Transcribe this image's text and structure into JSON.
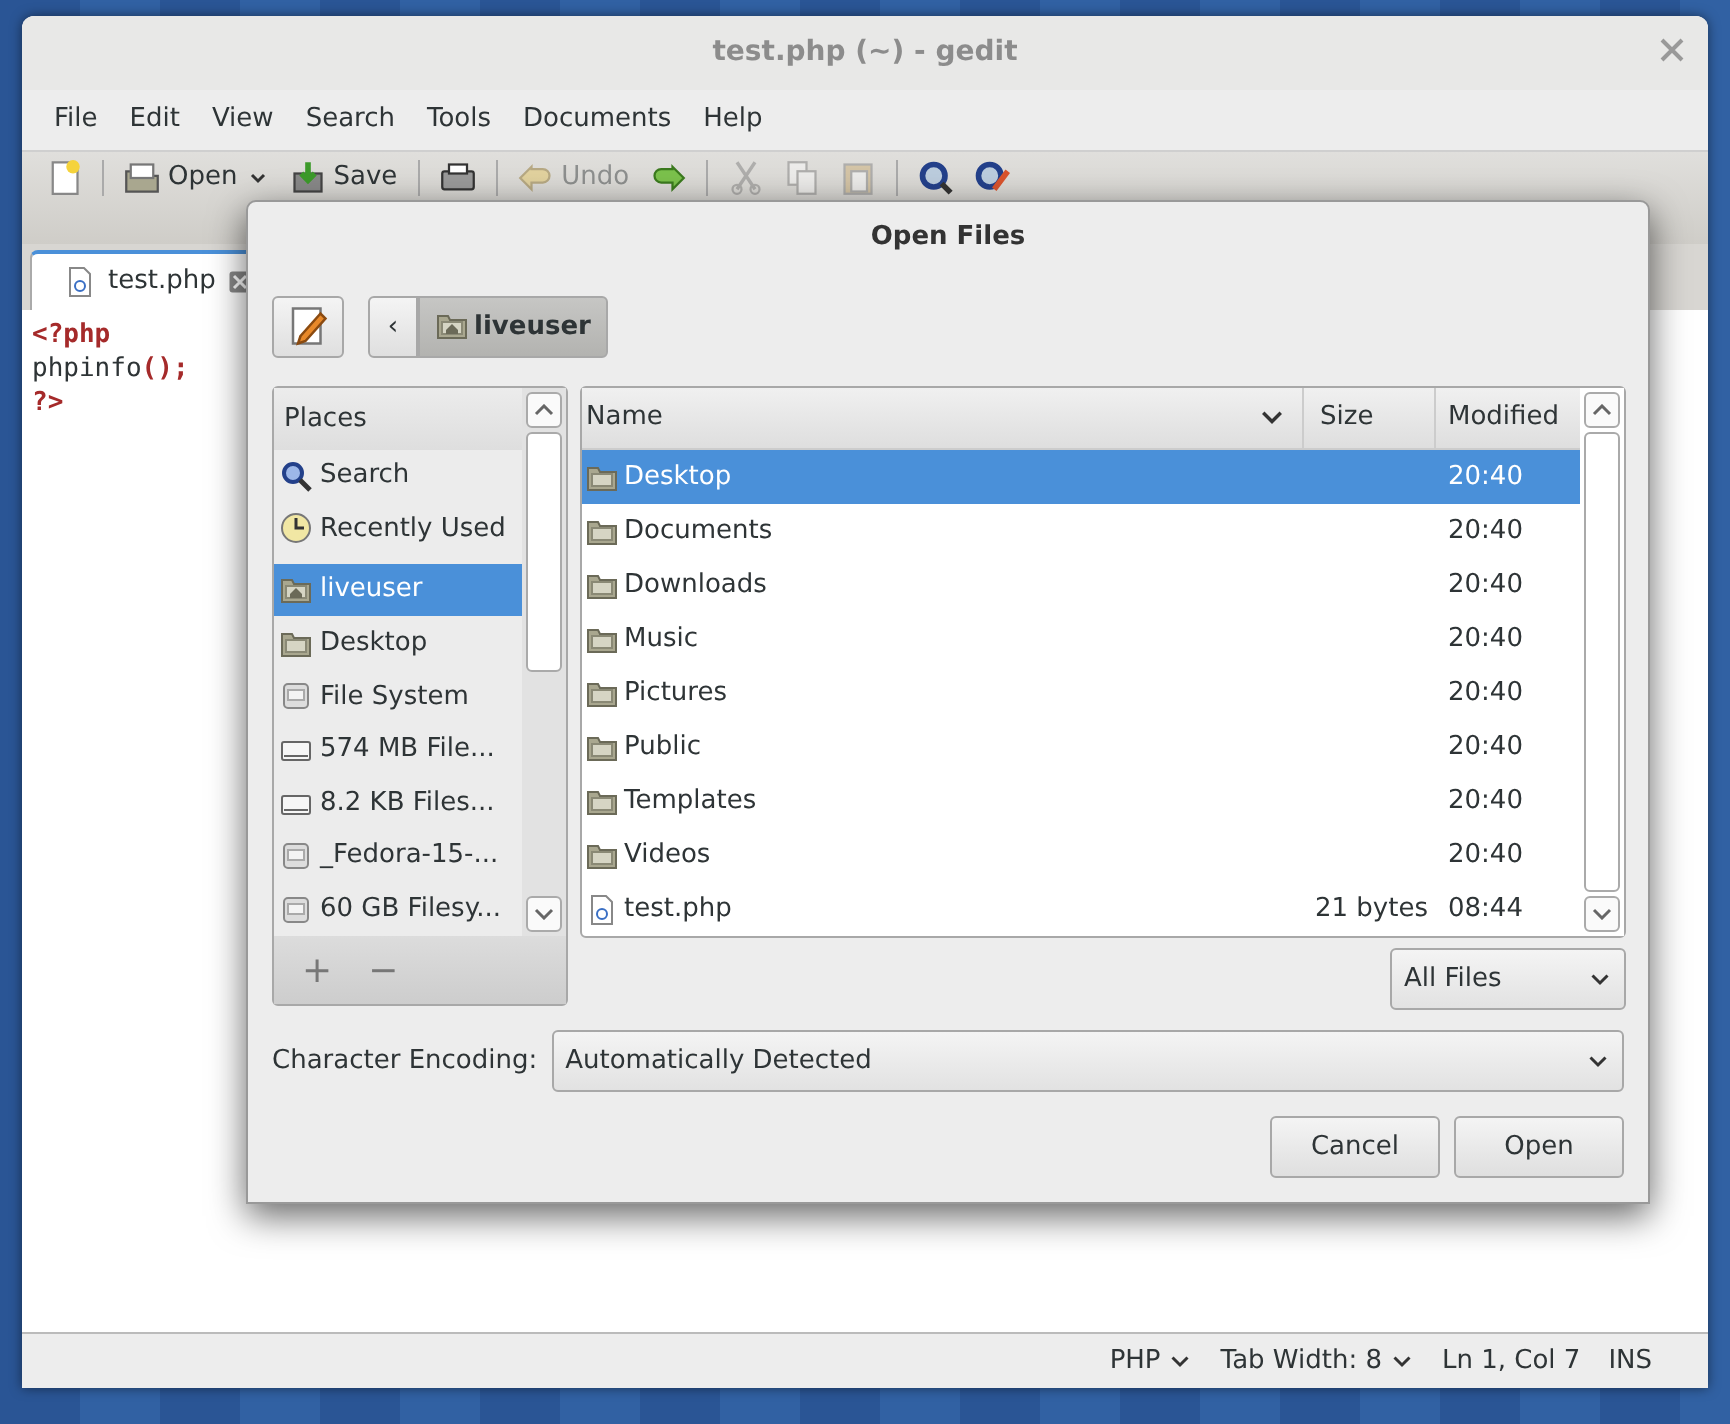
{
  "window": {
    "title": "test.php (~) - gedit"
  },
  "menu": [
    "File",
    "Edit",
    "View",
    "Search",
    "Tools",
    "Documents",
    "Help"
  ],
  "toolbar": [
    {
      "kind": "new",
      "disabled": false
    },
    {
      "kind": "open",
      "label": "Open",
      "disabled": false,
      "dropdown": true
    },
    {
      "kind": "save",
      "label": "Save",
      "disabled": false
    },
    {
      "kind": "print",
      "disabled": false
    },
    {
      "kind": "undo",
      "label": "Undo",
      "disabled": true
    },
    {
      "kind": "redo",
      "disabled": false
    },
    {
      "kind": "cut",
      "disabled": true
    },
    {
      "kind": "copy",
      "disabled": true
    },
    {
      "kind": "paste",
      "disabled": true
    },
    {
      "kind": "find",
      "disabled": false
    },
    {
      "kind": "replace",
      "disabled": false
    }
  ],
  "tabs": [
    {
      "label": "test.php",
      "selected": true
    }
  ],
  "code": [
    [
      {
        "text": "<?php",
        "kind": "keyword"
      }
    ],
    [
      {
        "text": "phpinfo",
        "kind": "plain"
      },
      {
        "text": "();",
        "kind": "keyword"
      }
    ],
    [
      {
        "text": "?>",
        "kind": "keyword"
      }
    ]
  ],
  "status_bar": {
    "language": "PHP",
    "tab_width": "Tab Width:  8",
    "position": "Ln 1, Col 7",
    "mode": "INS"
  },
  "dialog": {
    "title": "Open Files",
    "back": "‹",
    "path": [
      {
        "label": "liveuser",
        "selected": true
      }
    ],
    "places_header": "Places",
    "places": [
      {
        "label": "Search",
        "kind": "search",
        "selected": false
      },
      {
        "label": "Recently Used",
        "kind": "recent",
        "selected": false
      },
      {
        "label": "liveuser",
        "kind": "home",
        "selected": true
      },
      {
        "label": "Desktop",
        "kind": "folder",
        "selected": false
      },
      {
        "label": "File System",
        "kind": "disk",
        "selected": false
      },
      {
        "label": "574 MB File...",
        "kind": "drive",
        "selected": false
      },
      {
        "label": "8.2 KB Files...",
        "kind": "drive",
        "selected": false
      },
      {
        "label": "_Fedora-15-...",
        "kind": "disk",
        "selected": false
      },
      {
        "label": "60 GB Filesy...",
        "kind": "disk",
        "selected": false
      }
    ],
    "place_buttons": [
      "+",
      "−"
    ],
    "columns": [
      "Name",
      "Size",
      "Modified"
    ],
    "files": [
      {
        "name": "Desktop",
        "modified": "20:40",
        "kind": "folder",
        "selected": true
      },
      {
        "name": "Documents",
        "modified": "20:40",
        "kind": "folder",
        "selected": false
      },
      {
        "name": "Downloads",
        "modified": "20:40",
        "kind": "folder",
        "selected": false
      },
      {
        "name": "Music",
        "modified": "20:40",
        "kind": "folder",
        "selected": false
      },
      {
        "name": "Pictures",
        "modified": "20:40",
        "kind": "folder",
        "selected": false
      },
      {
        "name": "Public",
        "modified": "20:40",
        "kind": "folder",
        "selected": false
      },
      {
        "name": "Templates",
        "modified": "20:40",
        "kind": "folder",
        "selected": false
      },
      {
        "name": "Videos",
        "modified": "20:40",
        "kind": "folder",
        "selected": false
      },
      {
        "name": "test.php",
        "size": "21 bytes",
        "modified": "08:44",
        "kind": "file",
        "selected": false
      }
    ],
    "filter": "All Files",
    "encoding_label": "Character Encoding:",
    "encoding": "Automatically Detected",
    "buttons": [
      "Cancel",
      "Open"
    ]
  }
}
